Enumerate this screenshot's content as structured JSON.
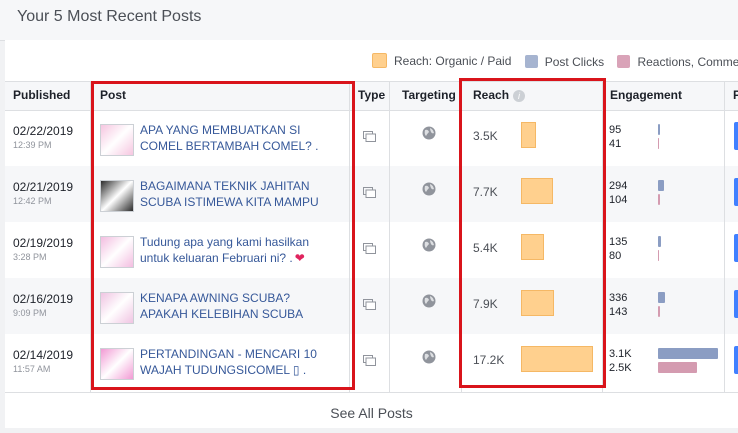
{
  "panel": {
    "title": "Your 5 Most Recent Posts"
  },
  "legend": [
    {
      "label": "Reach: Organic / Paid",
      "color": "#ffd08e"
    },
    {
      "label": "Post Clicks",
      "color": "#a6b4d0"
    },
    {
      "label": "Reactions, Comments",
      "color": "#d9a3b8"
    }
  ],
  "columns": {
    "published": "Published",
    "post": "Post",
    "type": "Type",
    "targeting": "Targeting",
    "reach": "Reach",
    "engagement": "Engagement",
    "promote": "P"
  },
  "posts": [
    {
      "date": "02/22/2019",
      "time": "12:39 PM",
      "text": "APA YANG MEMBUATKAN SI\nCOMEL BERTAMBAH COMEL? .",
      "reach": "3.5K",
      "reach_value": 3.5,
      "clicks": "95",
      "reactions": "41",
      "clicks_value": 95,
      "reactions_value": 41
    },
    {
      "date": "02/21/2019",
      "time": "12:42 PM",
      "text": "BAGAIMANA TEKNIK JAHITAN\nSCUBA ISTIMEWA KITA MAMPU",
      "reach": "7.7K",
      "reach_value": 7.7,
      "clicks": "294",
      "reactions": "104",
      "clicks_value": 294,
      "reactions_value": 104
    },
    {
      "date": "02/19/2019",
      "time": "3:28 PM",
      "text": "Tudung apa yang kami hasilkan\nuntuk keluaran Februari ni? .",
      "heart": true,
      "reach": "5.4K",
      "reach_value": 5.4,
      "clicks": "135",
      "reactions": "80",
      "clicks_value": 135,
      "reactions_value": 80
    },
    {
      "date": "02/16/2019",
      "time": "9:09 PM",
      "text": "KENAPA AWNING SCUBA?\nAPAKAH KELEBIHAN SCUBA",
      "reach": "7.9K",
      "reach_value": 7.9,
      "clicks": "336",
      "reactions": "143",
      "clicks_value": 336,
      "reactions_value": 143
    },
    {
      "date": "02/14/2019",
      "time": "11:57 AM",
      "text": "PERTANDINGAN - MENCARI 10\nWAJAH TUDUNGSICOMEL ▯ .",
      "reach": "17.2K",
      "reach_value": 17.2,
      "clicks": "3.1K",
      "reactions": "2.5K",
      "clicks_value": 3100,
      "reactions_value": 2500
    }
  ],
  "footer": {
    "see_all": "See All Posts"
  }
}
